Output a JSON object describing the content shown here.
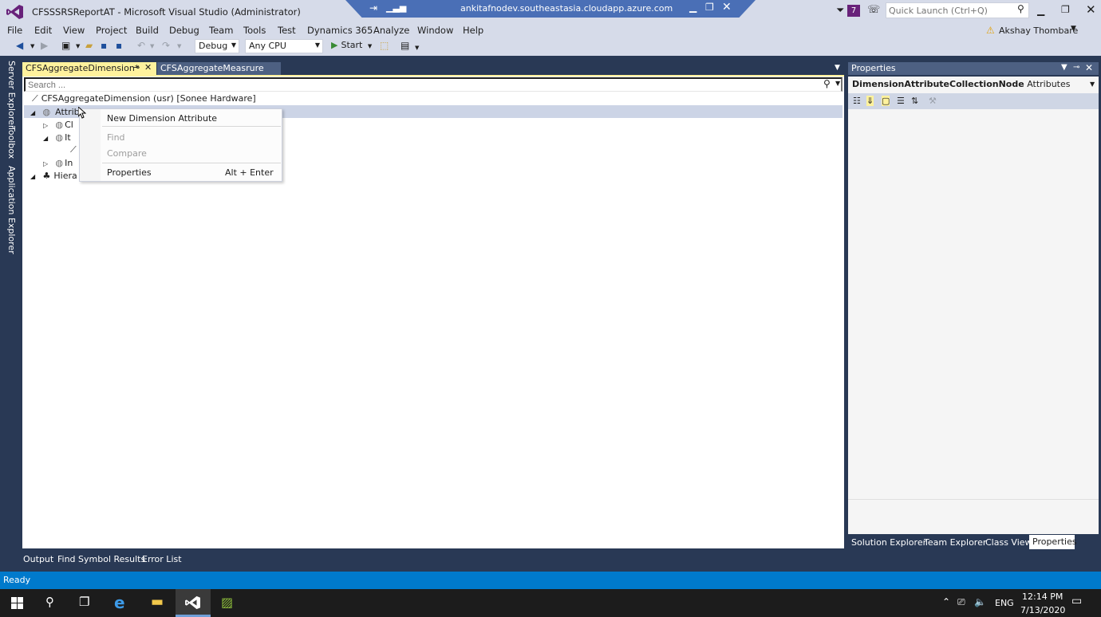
{
  "window": {
    "title": "CFSSSRSReportAT - Microsoft Visual Studio (Administrator)",
    "notification_count": "7",
    "quick_launch_placeholder": "Quick Launch (Ctrl+Q)"
  },
  "remote_session": {
    "host": "ankitafnodev.southeastasia.cloudapp.azure.com"
  },
  "menu": [
    "File",
    "Edit",
    "View",
    "Project",
    "Build",
    "Debug",
    "Team",
    "Tools",
    "Test",
    "Dynamics 365",
    "Analyze",
    "Window",
    "Help"
  ],
  "user": {
    "name": "Akshay Thombare"
  },
  "toolbar": {
    "configuration": "Debug",
    "platform": "Any CPU",
    "start_label": "Start"
  },
  "left_strip": [
    "Server Explorer",
    "Toolbox",
    "Application Explorer"
  ],
  "editor": {
    "tabs": [
      {
        "label": "CFSAggregateDimension*",
        "active": true
      },
      {
        "label": "CFSAggregateMeasrure",
        "active": false
      }
    ],
    "search_placeholder": "Search ...",
    "root_node": "CFSAggregateDimension (usr) [Sonee Hardware]",
    "nodes": [
      "Attrib",
      "Cl",
      "It",
      "In",
      "Hiera"
    ]
  },
  "context_menu": {
    "items": [
      {
        "label": "New Dimension Attribute",
        "shortcut": "",
        "enabled": true
      },
      {
        "label": "Find",
        "shortcut": "",
        "enabled": false
      },
      {
        "label": "Compare",
        "shortcut": "",
        "enabled": false
      },
      {
        "label": "Properties",
        "shortcut": "Alt + Enter",
        "enabled": true
      }
    ]
  },
  "properties": {
    "title": "Properties",
    "object_type": "DimensionAttributeCollectionNode",
    "object_name": "Attributes"
  },
  "right_tabs": [
    "Solution Explorer",
    "Team Explorer",
    "Class View",
    "Properties"
  ],
  "bottom_tabs": [
    "Output",
    "Find Symbol Results",
    "Error List"
  ],
  "status": {
    "text": "Ready"
  },
  "taskbar": {
    "language": "ENG",
    "time": "12:14 PM",
    "date": "7/13/2020"
  },
  "colors": {
    "accent": "#007acc",
    "active_tab": "#fff29d",
    "chrome": "#d6dbe9",
    "dark_frame": "#293955",
    "vs_purple": "#68217a"
  }
}
